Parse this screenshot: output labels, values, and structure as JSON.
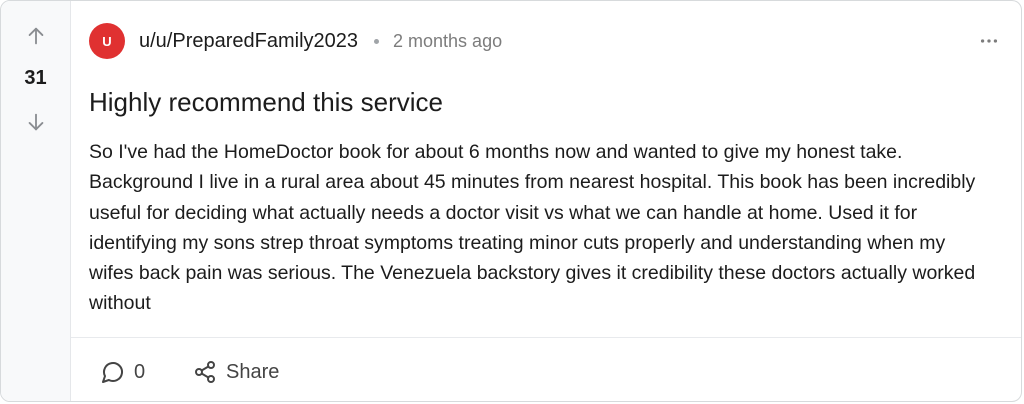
{
  "post": {
    "score": "31",
    "avatar_initial": "U",
    "author": "u/u/PreparedFamily2023",
    "separator": "•",
    "time": "2 months ago",
    "title": "Highly recommend this service",
    "body": "So I've had the HomeDoctor book for about 6 months now and wanted to give my honest take. Background I live in a rural area about 45 minutes from nearest hospital. This book has been incredibly useful for deciding what actually needs a doctor visit vs what we can handle at home. Used it for identifying my sons strep throat symptoms treating minor cuts properly and understanding when my wifes back pain was serious. The Venezuela backstory gives it credibility these doctors actually worked without"
  },
  "footer": {
    "comment_count": "0",
    "share_label": "Share"
  },
  "icons": {
    "upvote": "arrow-up-icon",
    "downvote": "arrow-down-icon",
    "more": "more-horizontal-icon",
    "comment": "comment-bubble-icon",
    "share": "share-nodes-icon"
  },
  "colors": {
    "avatar_bg": "#e03131",
    "text": "#1c1c1c",
    "muted": "#7c7c7c",
    "vote_column_bg": "#f8f9fa"
  }
}
